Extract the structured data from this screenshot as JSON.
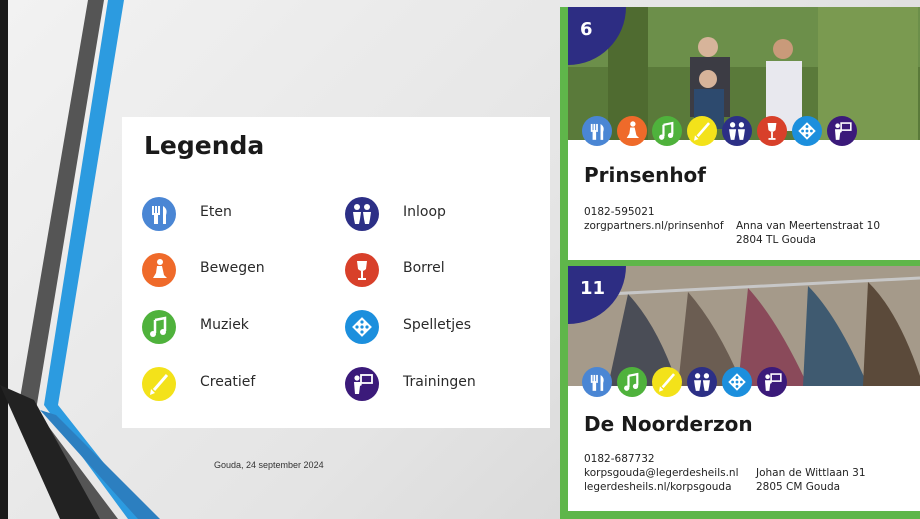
{
  "legend": {
    "title": "Legenda",
    "items": [
      {
        "label": "Eten",
        "icon": "cutlery-icon",
        "color": "#4a86d4"
      },
      {
        "label": "Bewegen",
        "icon": "exercise-icon",
        "color": "#ef6a2a"
      },
      {
        "label": "Muziek",
        "icon": "music-note-icon",
        "color": "#4fb23c"
      },
      {
        "label": "Creatief",
        "icon": "brush-icon",
        "color": "#f3e21a"
      },
      {
        "label": "Inloop",
        "icon": "people-icon",
        "color": "#2c2f86"
      },
      {
        "label": "Borrel",
        "icon": "wine-glass-icon",
        "color": "#d8402a"
      },
      {
        "label": "Spelletjes",
        "icon": "dice-icon",
        "color": "#1c8fdd"
      },
      {
        "label": "Trainingen",
        "icon": "presenter-icon",
        "color": "#3b1a7a"
      }
    ]
  },
  "footer": {
    "date": "Gouda, 24 september 2024"
  },
  "cards": [
    {
      "number": "6",
      "title": "Prinsenhof",
      "phone": "0182-595021",
      "website": "zorgpartners.nl/prinsenhof",
      "street": "Anna van Meertenstraat 10",
      "city": "2804 TL  Gouda",
      "icons": [
        "cutlery-icon",
        "exercise-icon",
        "music-note-icon",
        "brush-icon",
        "people-icon",
        "wine-glass-icon",
        "dice-icon",
        "presenter-icon"
      ]
    },
    {
      "number": "11",
      "title": "De Noorderzon",
      "phone": "0182-687732",
      "email": "korpsgouda@legerdesheils.nl",
      "website": "legerdesheils.nl/korpsgouda",
      "street": "Johan de Wittlaan 31",
      "city": "2805 CM Gouda",
      "icons": [
        "cutlery-icon",
        "music-note-icon",
        "brush-icon",
        "people-icon",
        "dice-icon",
        "presenter-icon"
      ]
    }
  ],
  "colors": {
    "panel_green": "#5fb64a",
    "badge_navy": "#2d2d83",
    "stripe_blue": "#2c9be0",
    "stripe_dark": "#3a3a3a"
  }
}
